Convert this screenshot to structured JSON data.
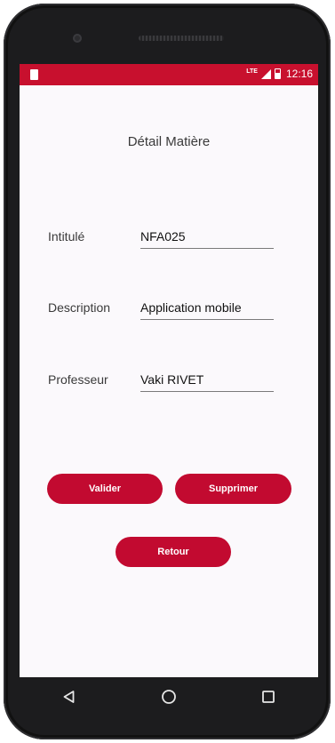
{
  "status_bar": {
    "time": "12:16",
    "network": "LTE",
    "accent_color": "#c8102e"
  },
  "screen": {
    "title": "Détail Matière"
  },
  "form": {
    "fields": [
      {
        "label": "Intitulé",
        "value": "NFA025"
      },
      {
        "label": "Description",
        "value": "Application mobile"
      },
      {
        "label": "Professeur",
        "value": "Vaki RIVET"
      }
    ]
  },
  "buttons": {
    "validate": "Valider",
    "delete": "Supprimer",
    "back": "Retour",
    "color": "#c20a30"
  },
  "nav_bar": {
    "icons": [
      "back-icon",
      "home-icon",
      "recents-icon"
    ]
  }
}
